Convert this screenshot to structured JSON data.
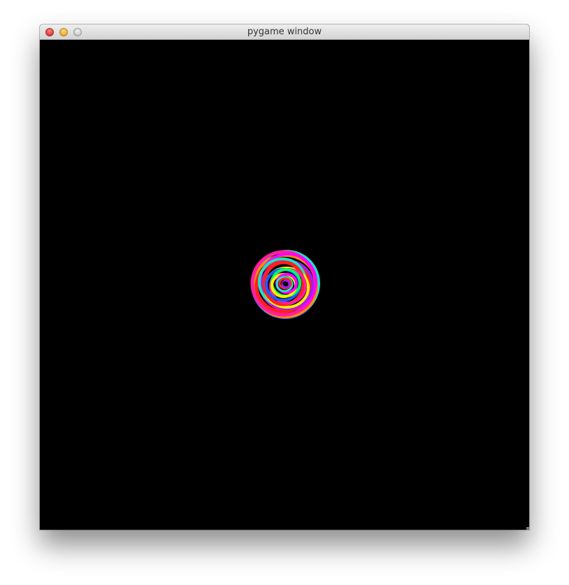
{
  "window": {
    "title": "pygame window",
    "background_color": "#000000"
  },
  "titlebar_buttons": [
    {
      "name": "close-button",
      "color": "#e0443c"
    },
    {
      "name": "minimize-button",
      "color": "#f0b13a"
    },
    {
      "name": "zoom-button",
      "color": "#cfcfcf"
    }
  ],
  "drawing": {
    "colors": [
      "#ff1fa0",
      "#ff2020",
      "#1a5cff",
      "#19e6c8",
      "#ffef00",
      "#a020f0",
      "#ff8c00",
      "#00ff66",
      "#ff00ff"
    ]
  }
}
